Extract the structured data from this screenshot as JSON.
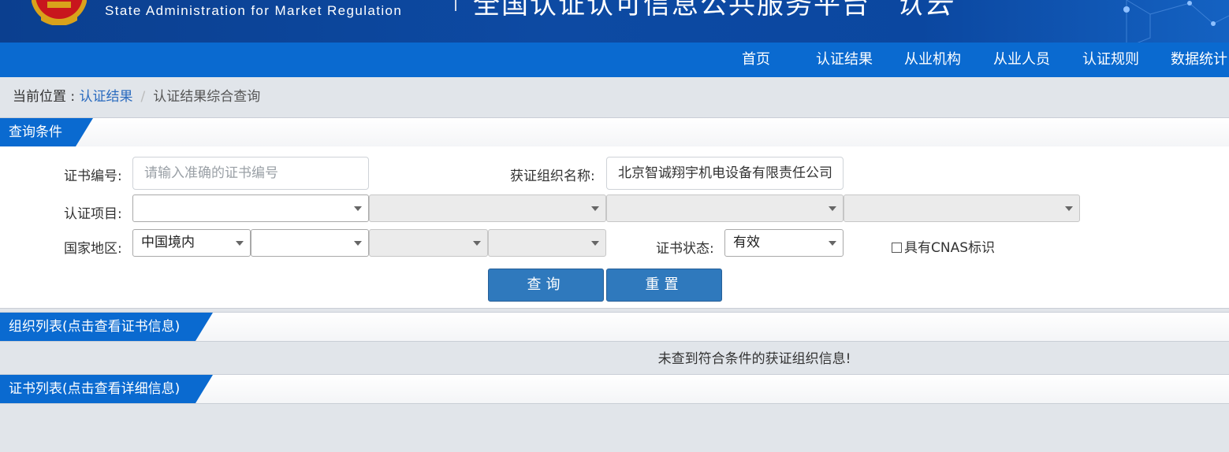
{
  "header": {
    "english_name": "State Administration  for  Market Regulation",
    "platform_title": "全国认证认可信息公共服务平台",
    "logo_suffix": "认云"
  },
  "nav": {
    "items": [
      "首页",
      "认证结果",
      "从业机构",
      "从业人员",
      "认证规则",
      "数据统计"
    ]
  },
  "breadcrumb": {
    "prefix": "当前位置 : ",
    "link": "认证结果",
    "separator": "/",
    "current": "认证结果综合查询"
  },
  "query_section": {
    "title": "查询条件",
    "cert_no_label": "证书编号:",
    "cert_no_placeholder": "请输入准确的证书编号",
    "org_name_label": "获证组织名称:",
    "org_name_value": "北京智诚翔宇机电设备有限责任公司",
    "project_label": "认证项目:",
    "project_selects": [
      "",
      "",
      "",
      ""
    ],
    "region_label": "国家地区:",
    "region_selects": [
      "中国境内",
      "",
      "",
      ""
    ],
    "status_label": "证书状态:",
    "status_value": "有效",
    "cnas_label": "具有CNAS标识",
    "search_button": "查询",
    "reset_button": "重置"
  },
  "org_list": {
    "title": "组织列表(点击查看证书信息)",
    "empty_message": "未查到符合条件的获证组织信息!"
  },
  "cert_list": {
    "title": "证书列表(点击查看详细信息)"
  },
  "colors": {
    "banner": "#0d4aa3",
    "nav": "#0a6ad0",
    "button": "#2f79bd",
    "link": "#2a6bbf"
  }
}
